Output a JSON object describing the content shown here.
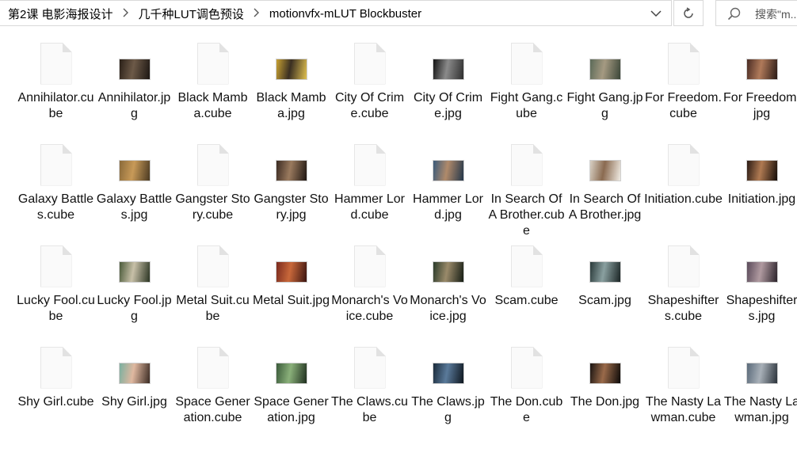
{
  "breadcrumbs": [
    "第2课 电影海报设计",
    "几千种LUT调色预设",
    "motionvfx-mLUT Blockbuster"
  ],
  "search": {
    "placeholder": "搜索\"m..."
  },
  "files": [
    {
      "label": "Annihilator.cube",
      "type": "cube"
    },
    {
      "label": "Annihilator.jpg",
      "type": "jpg",
      "colors": [
        "#2a2018",
        "#6d5a48",
        "#1c1612"
      ]
    },
    {
      "label": "Black Mamba.cube",
      "type": "cube"
    },
    {
      "label": "Black Mamba.jpg",
      "type": "jpg",
      "colors": [
        "#c9a233",
        "#3a2f22",
        "#e0c050"
      ]
    },
    {
      "label": "City Of Crime.cube",
      "type": "cube"
    },
    {
      "label": "City Of Crime.jpg",
      "type": "jpg",
      "colors": [
        "#141414",
        "#8a8a8a",
        "#2e2e2e"
      ]
    },
    {
      "label": "Fight Gang.cube",
      "type": "cube"
    },
    {
      "label": "Fight Gang.jpg",
      "type": "jpg",
      "colors": [
        "#5b6a58",
        "#a59a82",
        "#3a4638"
      ]
    },
    {
      "label": "For Freedom.cube",
      "type": "cube"
    },
    {
      "label": "For Freedom.jpg",
      "type": "jpg",
      "colors": [
        "#4a2c24",
        "#b07a5a",
        "#2a1a16"
      ]
    },
    {
      "label": "Galaxy Battles.cube",
      "type": "cube"
    },
    {
      "label": "Galaxy Battles.jpg",
      "type": "jpg",
      "colors": [
        "#8a6a3a",
        "#c89a58",
        "#4a3a22"
      ]
    },
    {
      "label": "Gangster Story.cube",
      "type": "cube"
    },
    {
      "label": "Gangster Story.jpg",
      "type": "jpg",
      "colors": [
        "#3a2a22",
        "#9a7a5e",
        "#1e1612"
      ]
    },
    {
      "label": "Hammer Lord.cube",
      "type": "cube"
    },
    {
      "label": "Hammer Lord.jpg",
      "type": "jpg",
      "colors": [
        "#3a5a7a",
        "#b08a6a",
        "#22364a"
      ]
    },
    {
      "label": "In Search Of A Brother.cube",
      "type": "cube"
    },
    {
      "label": "In Search Of A Brother.jpg",
      "type": "jpg",
      "colors": [
        "#d8d0c4",
        "#8a6a50",
        "#f0ece4"
      ]
    },
    {
      "label": "Initiation.cube",
      "type": "cube"
    },
    {
      "label": "Initiation.jpg",
      "type": "jpg",
      "colors": [
        "#2a1a14",
        "#b07a52",
        "#140c08"
      ]
    },
    {
      "label": "Lucky Fool.cube",
      "type": "cube"
    },
    {
      "label": "Lucky Fool.jpg",
      "type": "jpg",
      "colors": [
        "#4a5a3a",
        "#c8c0a8",
        "#2a3422"
      ]
    },
    {
      "label": "Metal Suit.cube",
      "type": "cube"
    },
    {
      "label": "Metal Suit.jpg",
      "type": "jpg",
      "colors": [
        "#7a2a1e",
        "#c8683a",
        "#3a1410"
      ]
    },
    {
      "label": "Monarch's Voice.cube",
      "type": "cube"
    },
    {
      "label": "Monarch's Voice.jpg",
      "type": "jpg",
      "colors": [
        "#2a3a2a",
        "#9a8a6a",
        "#141c14"
      ]
    },
    {
      "label": "Scam.cube",
      "type": "cube"
    },
    {
      "label": "Scam.jpg",
      "type": "jpg",
      "colors": [
        "#2a3a3a",
        "#8aa0a0",
        "#1a2424"
      ]
    },
    {
      "label": "Shapeshifters.cube",
      "type": "cube"
    },
    {
      "label": "Shapeshifters.jpg",
      "type": "jpg",
      "colors": [
        "#5a4a5a",
        "#b09aa0",
        "#2a222a"
      ]
    },
    {
      "label": "Shy Girl.cube",
      "type": "cube"
    },
    {
      "label": "Shy Girl.jpg",
      "type": "jpg",
      "colors": [
        "#7ab0a0",
        "#e0b8a0",
        "#3a2a22"
      ]
    },
    {
      "label": "Space Generation.cube",
      "type": "cube"
    },
    {
      "label": "Space Generation.jpg",
      "type": "jpg",
      "colors": [
        "#3a5a3a",
        "#8ab07a",
        "#1e2e1e"
      ]
    },
    {
      "label": "The Claws.cube",
      "type": "cube"
    },
    {
      "label": "The Claws.jpg",
      "type": "jpg",
      "colors": [
        "#1a2a3a",
        "#5a7a9a",
        "#0e161e"
      ]
    },
    {
      "label": "The Don.cube",
      "type": "cube"
    },
    {
      "label": "The Don.jpg",
      "type": "jpg",
      "colors": [
        "#1a1412",
        "#9a6a4a",
        "#0c0a08"
      ]
    },
    {
      "label": "The Nasty Lawman.cube",
      "type": "cube"
    },
    {
      "label": "The Nasty Lawman.jpg",
      "type": "jpg",
      "colors": [
        "#5a6a7a",
        "#a8b0b8",
        "#2a323a"
      ]
    }
  ],
  "icons": {
    "separator": "chevron-right-icon",
    "dropdown": "chevron-down-icon",
    "refresh": "refresh-icon",
    "search": "search-icon",
    "cube_file": "blank-document-icon",
    "jpg_file": "image-thumbnail"
  }
}
